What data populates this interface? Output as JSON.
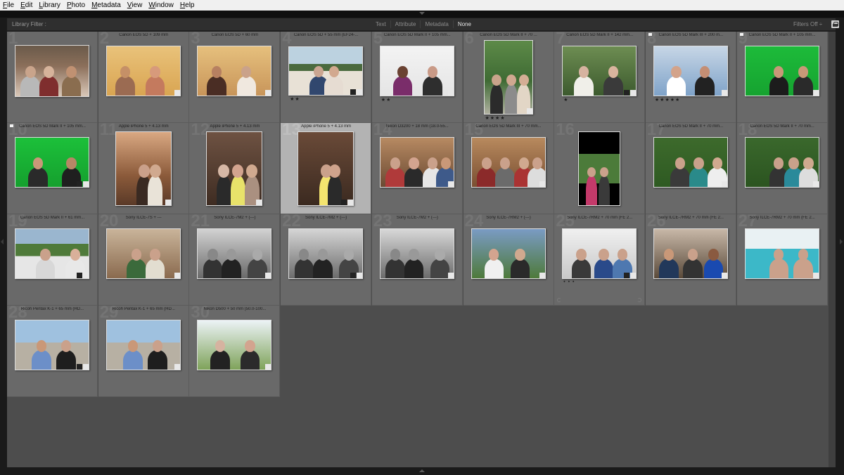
{
  "menubar": {
    "items": [
      "File",
      "Edit",
      "Library",
      "Photo",
      "Metadata",
      "View",
      "Window",
      "Help"
    ]
  },
  "filterbar": {
    "title": "Library Filter :",
    "options": [
      "Text",
      "Attribute",
      "Metadata",
      "None"
    ],
    "active_option": "None",
    "filters_status": "Filters Off ÷"
  },
  "colors": {
    "cell": "#696969",
    "selected_cell": "#b3b3b3",
    "grid_bg": "#4d4d4d"
  },
  "grid": {
    "cells": [
      {
        "num": "1",
        "caption": "",
        "stars": "",
        "flag": false
      },
      {
        "num": "2",
        "caption": "Canon EOS 5D + 109 mm",
        "stars": "",
        "flag": false
      },
      {
        "num": "3",
        "caption": "Canon EOS 5D + 60 mm",
        "stars": "",
        "flag": false
      },
      {
        "num": "4",
        "caption": "Canon EOS 5D + 55 mm (EF24-...",
        "stars": "★★",
        "flag": false
      },
      {
        "num": "5",
        "caption": "Canon EOS 5D Mark II + 105 mm...",
        "stars": "★★",
        "flag": false
      },
      {
        "num": "6",
        "caption": "Canon EOS 5D Mark II + 70 ...",
        "stars": "★★★★",
        "flag": false
      },
      {
        "num": "7",
        "caption": "Canon EOS 5D Mark II + 142 mm...",
        "stars": "★",
        "flag": false
      },
      {
        "num": "8",
        "caption": "Canon EOS 5D Mark III + 200 m...",
        "stars": "★★★★★",
        "flag": true
      },
      {
        "num": "9",
        "caption": "Canon EOS 5D Mark II + 105 mm...",
        "stars": "",
        "flag": true
      },
      {
        "num": "10",
        "caption": "Canon EOS 5D Mark II + 105 mm...",
        "stars": "",
        "flag": true
      },
      {
        "num": "11",
        "caption": "Apple iPhone 5 + 4.13 mm",
        "stars": "",
        "flag": false
      },
      {
        "num": "12",
        "caption": "Apple iPhone 5 + 4.13 mm",
        "stars": "",
        "flag": false
      },
      {
        "num": "13",
        "caption": "Apple iPhone 5 + 4.13 mm",
        "stars": "",
        "flag": false
      },
      {
        "num": "14",
        "caption": "Nikon D3200 + 18 mm (18.0-55...",
        "stars": "",
        "flag": false
      },
      {
        "num": "15",
        "caption": "Canon EOS 5D Mark III + 70 mm...",
        "stars": "",
        "flag": false
      },
      {
        "num": "16",
        "caption": "",
        "stars": "",
        "flag": false
      },
      {
        "num": "17",
        "caption": "Canon EOS 5D Mark II + 70 mm...",
        "stars": "",
        "flag": false
      },
      {
        "num": "18",
        "caption": "Canon EOS 5D Mark II + 70 mm...",
        "stars": "",
        "flag": false
      },
      {
        "num": "19",
        "caption": "Canon EOS 5D Mark II + 61 mm...",
        "stars": "",
        "flag": false
      },
      {
        "num": "20",
        "caption": "Sony ILCE-7S + ---",
        "stars": "",
        "flag": false
      },
      {
        "num": "21",
        "caption": "Sony ILCE-7M2 + (---)",
        "stars": "",
        "flag": false
      },
      {
        "num": "22",
        "caption": "Sony ILCE-7M2 + (---)",
        "stars": "",
        "flag": false
      },
      {
        "num": "23",
        "caption": "Sony ILCE-7M2 + (---)",
        "stars": "",
        "flag": false
      },
      {
        "num": "24",
        "caption": "Sony ILCE-7RM2 + (---)",
        "stars": "",
        "flag": false
      },
      {
        "num": "25",
        "caption": "Sony ILCE-7RM2 + 70 mm (FE 2...",
        "stars": "• • •",
        "flag": false
      },
      {
        "num": "26",
        "caption": "Sony ILCE-7RM2 + 70 mm (FE 2...",
        "stars": "",
        "flag": false
      },
      {
        "num": "27",
        "caption": "Sony ILCE-7RM2 + 70 mm (FE 2...",
        "stars": "",
        "flag": false
      },
      {
        "num": "28",
        "caption": "Ricoh Pentax K-1 + 65 mm (HD...",
        "stars": "",
        "flag": false
      },
      {
        "num": "29",
        "caption": "Ricoh Pentax K-1 + 65 mm (HD...",
        "stars": "",
        "flag": false
      },
      {
        "num": "30",
        "caption": "Nikon D500 + 50 mm (50.0-100...",
        "stars": "",
        "flag": false
      }
    ]
  }
}
